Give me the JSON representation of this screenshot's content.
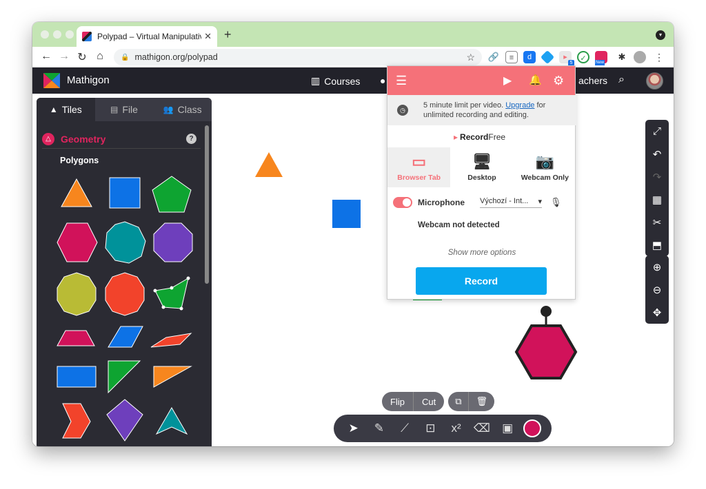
{
  "browser": {
    "tab_title": "Polypad – Virtual Manipulatives",
    "tab_close": "✕",
    "new_tab": "+",
    "url": "mathigon.org/polypad",
    "ext_badge": "5",
    "ext_new_badge": "New"
  },
  "app": {
    "brand": "Mathigon",
    "nav": [
      {
        "label": "Courses",
        "icon": "books-icon"
      },
      {
        "label": "achers",
        "icon": "teachers-icon"
      }
    ]
  },
  "panel": {
    "tabs": [
      {
        "label": "Tiles",
        "icon": "shapes-icon"
      },
      {
        "label": "File",
        "icon": "file-icon"
      },
      {
        "label": "Class",
        "icon": "class-icon"
      }
    ],
    "section": "Geometry",
    "help": "?",
    "subsection": "Polygons"
  },
  "bottom": {
    "flip": "Flip",
    "cut": "Cut",
    "tools": [
      "pointer-icon",
      "pen-icon",
      "line-icon",
      "text-icon",
      "equation-icon",
      "eraser-icon",
      "image-icon"
    ],
    "x2": "x²",
    "color": "#d1125a"
  },
  "popup": {
    "limit_text": "5 minute limit per video.",
    "upgrade": "Upgrade",
    "limit_rest": "for unlimited recording and editing.",
    "logo_bold": "Record",
    "logo_light": "Free",
    "modes": [
      {
        "label": "Browser Tab",
        "active": true
      },
      {
        "label": "Desktop",
        "active": false
      },
      {
        "label": "Webcam Only",
        "active": false
      }
    ],
    "mic_label": "Microphone",
    "mic_device": "Výchozí - Int...",
    "webcam_msg": "Webcam not detected",
    "more_options": "Show more options",
    "record": "Record"
  },
  "colors": {
    "accent_pink": "#e0245e",
    "popup_header": "#f57179",
    "record_blue": "#08a7ee",
    "orange": "#f7861e",
    "blue": "#0d72e6",
    "green": "#0ea431",
    "teal": "#00929a",
    "purple": "#6e3fbc",
    "olive": "#b9bb35",
    "red": "#f2432b"
  }
}
